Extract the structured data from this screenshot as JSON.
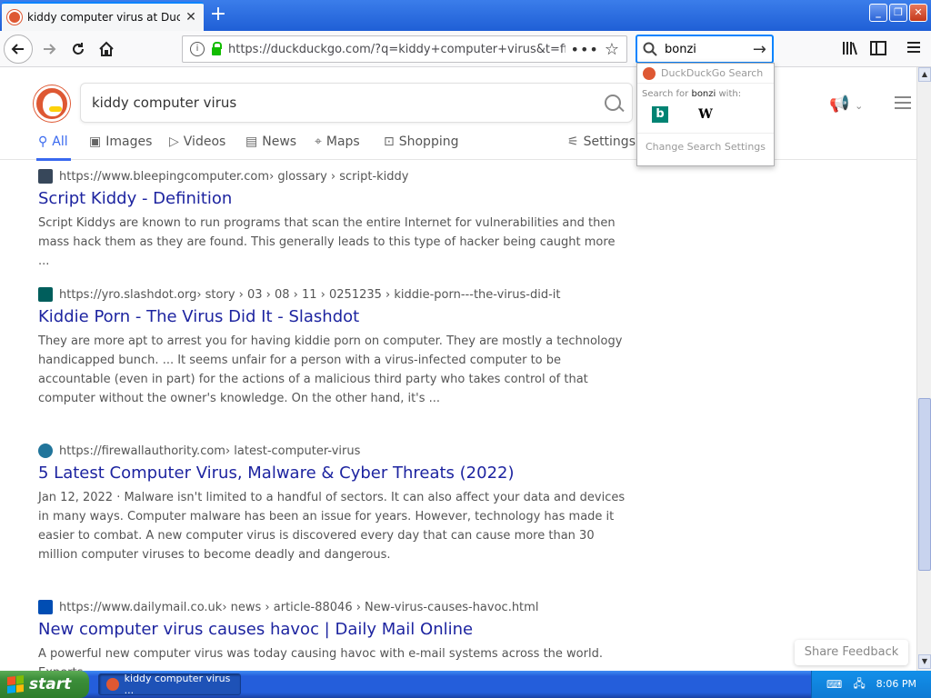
{
  "browser": {
    "tab_title": "kiddy computer virus at DuckDuckGo",
    "url": "https://duckduckgo.com/?q=kiddy+computer+virus&t=ffhp&i",
    "search_value": "bonzi"
  },
  "page": {
    "query": "kiddy computer virus",
    "tabs": [
      {
        "label": "All",
        "icon": "search-icon"
      },
      {
        "label": "Images",
        "icon": "image-icon"
      },
      {
        "label": "Videos",
        "icon": "play-icon"
      },
      {
        "label": "News",
        "icon": "newspaper-icon"
      },
      {
        "label": "Maps",
        "icon": "map-pin-icon"
      },
      {
        "label": "Shopping",
        "icon": "bag-icon"
      }
    ],
    "settings_label": "Settings",
    "results": [
      {
        "url": "https://www.bleepingcomputer.com",
        "path": " › glossary › script-kiddy",
        "title": "Script Kiddy - Definition",
        "snippet": "Script Kiddys are known to run programs that scan the entire Internet for vulnerabilities and then mass hack them as they are found. This generally leads to this type of hacker being caught more ..."
      },
      {
        "url": "https://yro.slashdot.org",
        "path": " › story › 03 › 08 › 11 › 0251235 › kiddie-porn---the-virus-did-it",
        "title": "Kiddie Porn - The Virus Did It - Slashdot",
        "snippet": "They are more apt to arrest you for having kiddie porn on computer. They are mostly a technology handicapped bunch. ... It seems unfair for a person with a virus-infected computer to be accountable (even in part) for the actions of a malicious third party who takes control of that computer without the owner's knowledge. On the other hand, it's ..."
      },
      {
        "url": "https://firewallauthority.com",
        "path": " › latest-computer-virus",
        "title": "5 Latest Computer Virus, Malware & Cyber Threats (2022)",
        "snippet": "Jan 12, 2022 · Malware isn't limited to a handful of sectors. It can also affect your data and devices in many ways. Computer malware has been an issue for years. However, technology has made it easier to combat. A new computer virus is discovered every day that can cause more than 30 million computer viruses to become deadly and dangerous."
      },
      {
        "url": "https://www.dailymail.co.uk",
        "path": " › news › article-88046 › New-virus-causes-havoc.html",
        "title": "New computer virus causes havoc | Daily Mail Online",
        "snippet": "A powerful new computer virus was today causing havoc with e-mail systems across the world. Experts"
      }
    ],
    "share_feedback": "Share Feedback"
  },
  "dropdown": {
    "header": "DuckDuckGo Search",
    "search_for_prefix": "Search for ",
    "search_for_term": "bonzi",
    "search_for_suffix": " with:",
    "engine_bing": "b",
    "engine_wiki": "W",
    "change_settings": "Change Search Settings"
  },
  "taskbar": {
    "start_label": "start",
    "task_label": "kiddy computer virus ...",
    "clock": "8:06 PM"
  },
  "colors": {
    "link": "#1d24a0",
    "accent": "#3969ef",
    "ddg_orange": "#de5833"
  }
}
